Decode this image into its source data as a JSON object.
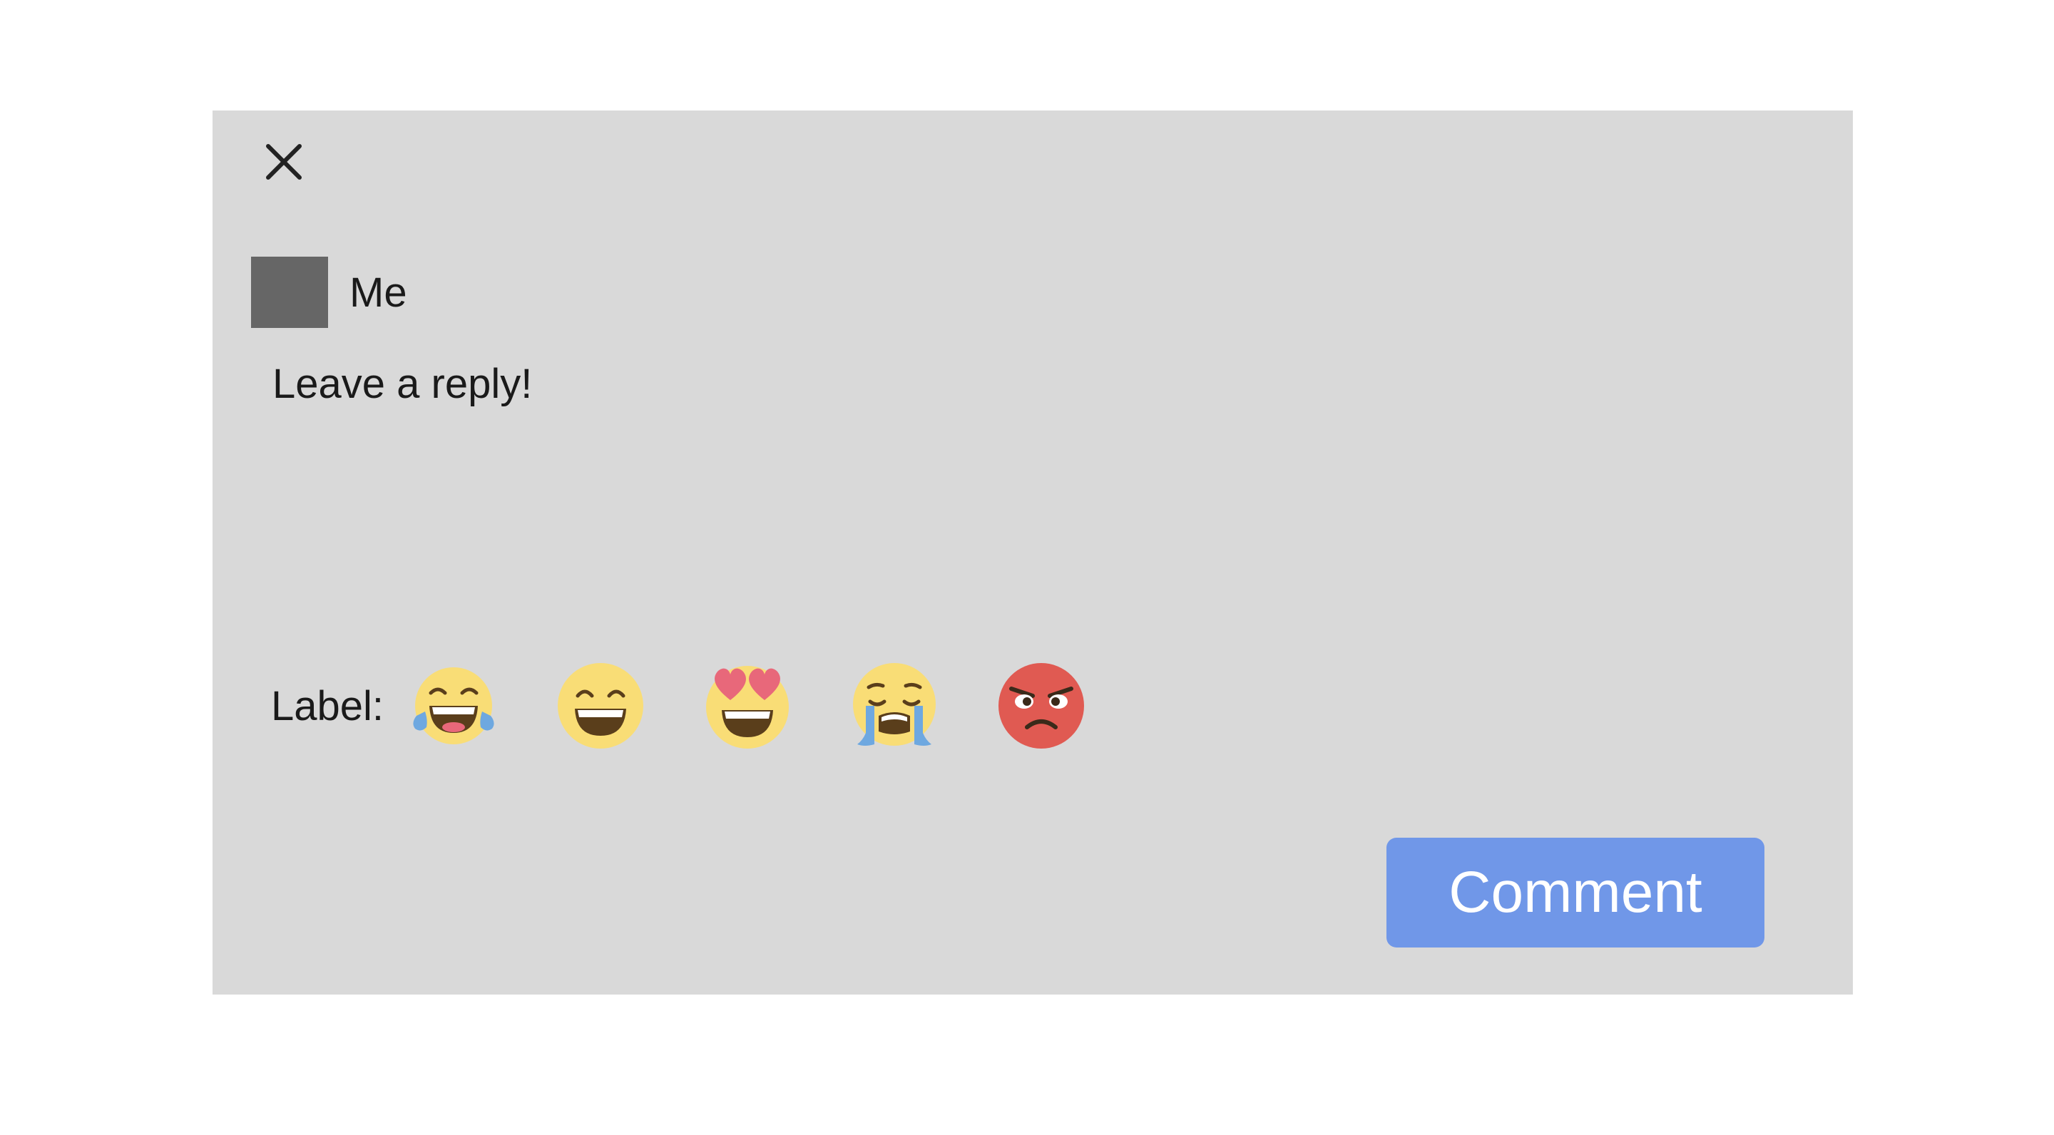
{
  "dialog": {
    "user": {
      "name": "Me"
    },
    "reply": {
      "placeholder": "Leave a reply!",
      "value": ""
    },
    "label": {
      "text": "Label:",
      "options": [
        {
          "icon": "tears-of-joy-icon"
        },
        {
          "icon": "grinning-icon"
        },
        {
          "icon": "heart-eyes-icon"
        },
        {
          "icon": "crying-icon"
        },
        {
          "icon": "angry-icon"
        }
      ]
    },
    "submit_label": "Comment"
  },
  "colors": {
    "panel_bg": "#d9d9d9",
    "avatar": "#666666",
    "button": "#7097e8",
    "emoji_yellow": "#f9dd76",
    "emoji_red": "#e05a52",
    "tear_blue": "#6ea8e0"
  }
}
